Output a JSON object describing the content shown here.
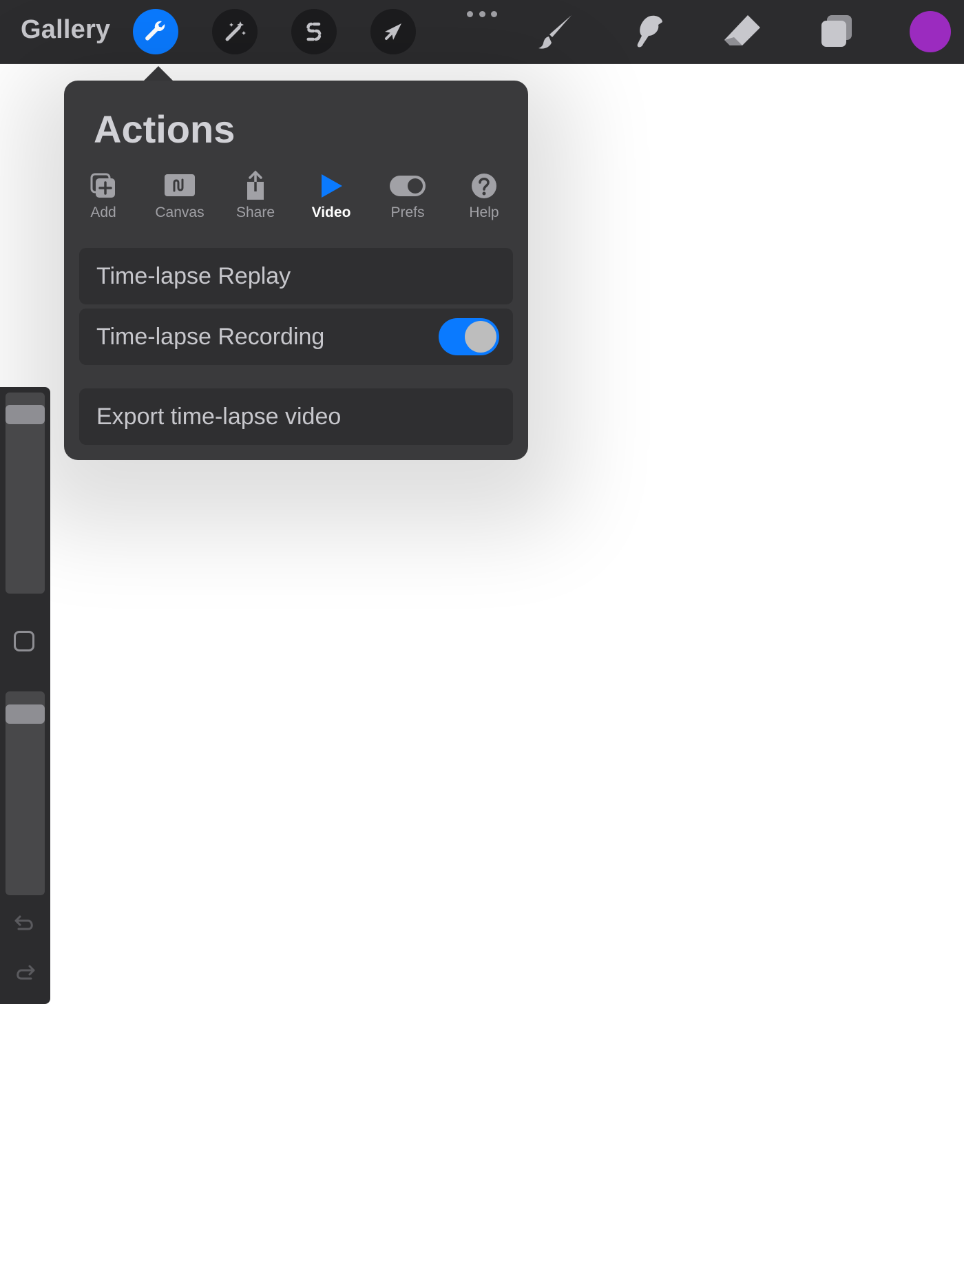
{
  "toolbar": {
    "gallery_label": "Gallery",
    "buttons": [
      {
        "name": "actions",
        "icon": "wrench-icon",
        "active": true
      },
      {
        "name": "adjustments",
        "icon": "magic-wand-icon",
        "active": false
      },
      {
        "name": "selection",
        "icon": "selection-s-icon",
        "active": false
      },
      {
        "name": "transform",
        "icon": "arrow-cursor-icon",
        "active": false
      }
    ],
    "tools": [
      "brush-icon",
      "smudge-icon",
      "eraser-icon",
      "layers-icon"
    ],
    "current_color": "#9b2bbf",
    "accent_color": "#0a7aff"
  },
  "actions_popover": {
    "title": "Actions",
    "tabs": [
      {
        "label": "Add",
        "icon": "add-image-icon"
      },
      {
        "label": "Canvas",
        "icon": "canvas-icon"
      },
      {
        "label": "Share",
        "icon": "share-icon"
      },
      {
        "label": "Video",
        "icon": "play-icon"
      },
      {
        "label": "Prefs",
        "icon": "toggle-icon"
      },
      {
        "label": "Help",
        "icon": "help-icon"
      }
    ],
    "active_tab": "Video",
    "items": {
      "replay_label": "Time-lapse Replay",
      "recording_label": "Time-lapse Recording",
      "recording_enabled": true,
      "export_label": "Export time-lapse video"
    }
  },
  "sidebar": {
    "brush_size_level": 0.93,
    "opacity_level": 0.93,
    "icons": [
      "modify-square-icon",
      "undo-icon",
      "redo-icon"
    ]
  }
}
